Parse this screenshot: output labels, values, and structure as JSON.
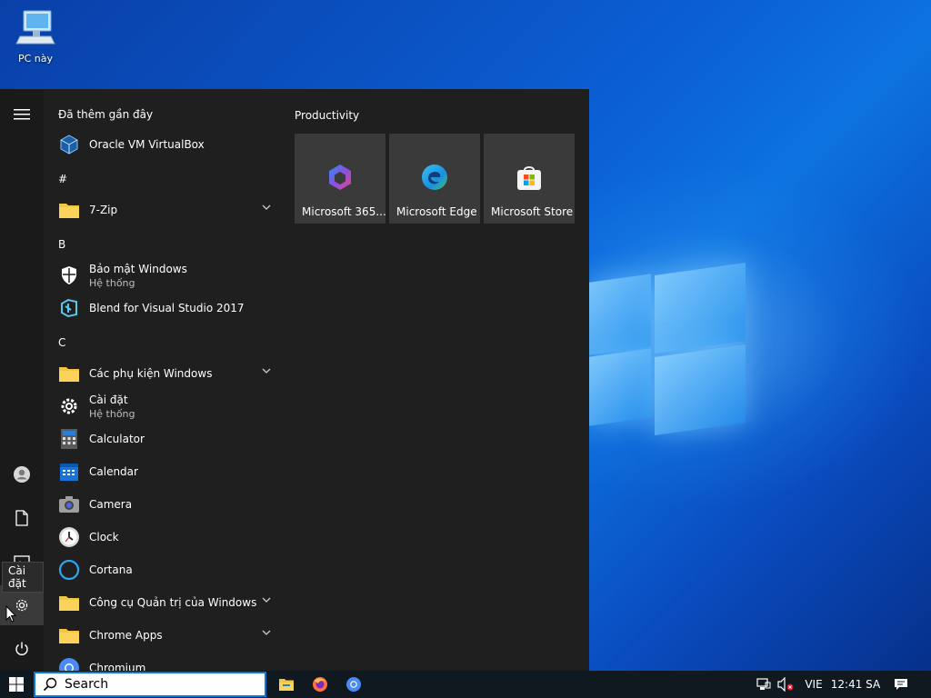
{
  "desktop": {
    "icon_label": "PC này"
  },
  "start_menu": {
    "tooltip": "Cài đặt",
    "recent_header": "Đã thêm gần đây",
    "apps": [
      {
        "name": "Oracle VM VirtualBox",
        "sub": "",
        "icon": "virtualbox-icon"
      },
      {
        "header": "#"
      },
      {
        "name": "7-Zip",
        "sub": "",
        "icon": "folder-icon",
        "expandable": true
      },
      {
        "header": "B"
      },
      {
        "name": "Bảo mật Windows",
        "sub": "Hệ thống",
        "icon": "shield-icon"
      },
      {
        "name": "Blend for Visual Studio 2017",
        "sub": "",
        "icon": "blend-icon"
      },
      {
        "header": "C"
      },
      {
        "name": "Các phụ kiện Windows",
        "sub": "",
        "icon": "folder-icon",
        "expandable": true
      },
      {
        "name": "Cài đặt",
        "sub": "Hệ thống",
        "icon": "gear-icon"
      },
      {
        "name": "Calculator",
        "sub": "",
        "icon": "calculator-icon"
      },
      {
        "name": "Calendar",
        "sub": "",
        "icon": "calendar-icon"
      },
      {
        "name": "Camera",
        "sub": "",
        "icon": "camera-icon"
      },
      {
        "name": "Clock",
        "sub": "",
        "icon": "clock-icon"
      },
      {
        "name": "Cortana",
        "sub": "",
        "icon": "cortana-icon"
      },
      {
        "name": "Công cụ Quản trị của Windows",
        "sub": "",
        "icon": "folder-icon",
        "expandable": true
      },
      {
        "name": "Chrome Apps",
        "sub": "",
        "icon": "folder-icon",
        "expandable": true
      },
      {
        "name": "Chromium",
        "sub": "",
        "icon": "chromium-icon"
      }
    ],
    "tiles_group": "Productivity",
    "tiles": [
      {
        "label": "Microsoft 365...",
        "icon": "m365-icon"
      },
      {
        "label": "Microsoft Edge",
        "icon": "edge-icon"
      },
      {
        "label": "Microsoft Store",
        "icon": "store-icon"
      }
    ]
  },
  "taskbar": {
    "search_placeholder": "Search",
    "language": "VIE",
    "time": "12:41 SA"
  },
  "colors": {
    "start_bg": "#1f1f1f",
    "tile_bg": "#3a3a3a",
    "accent": "#0a78d7",
    "folder": "#f4c542"
  }
}
